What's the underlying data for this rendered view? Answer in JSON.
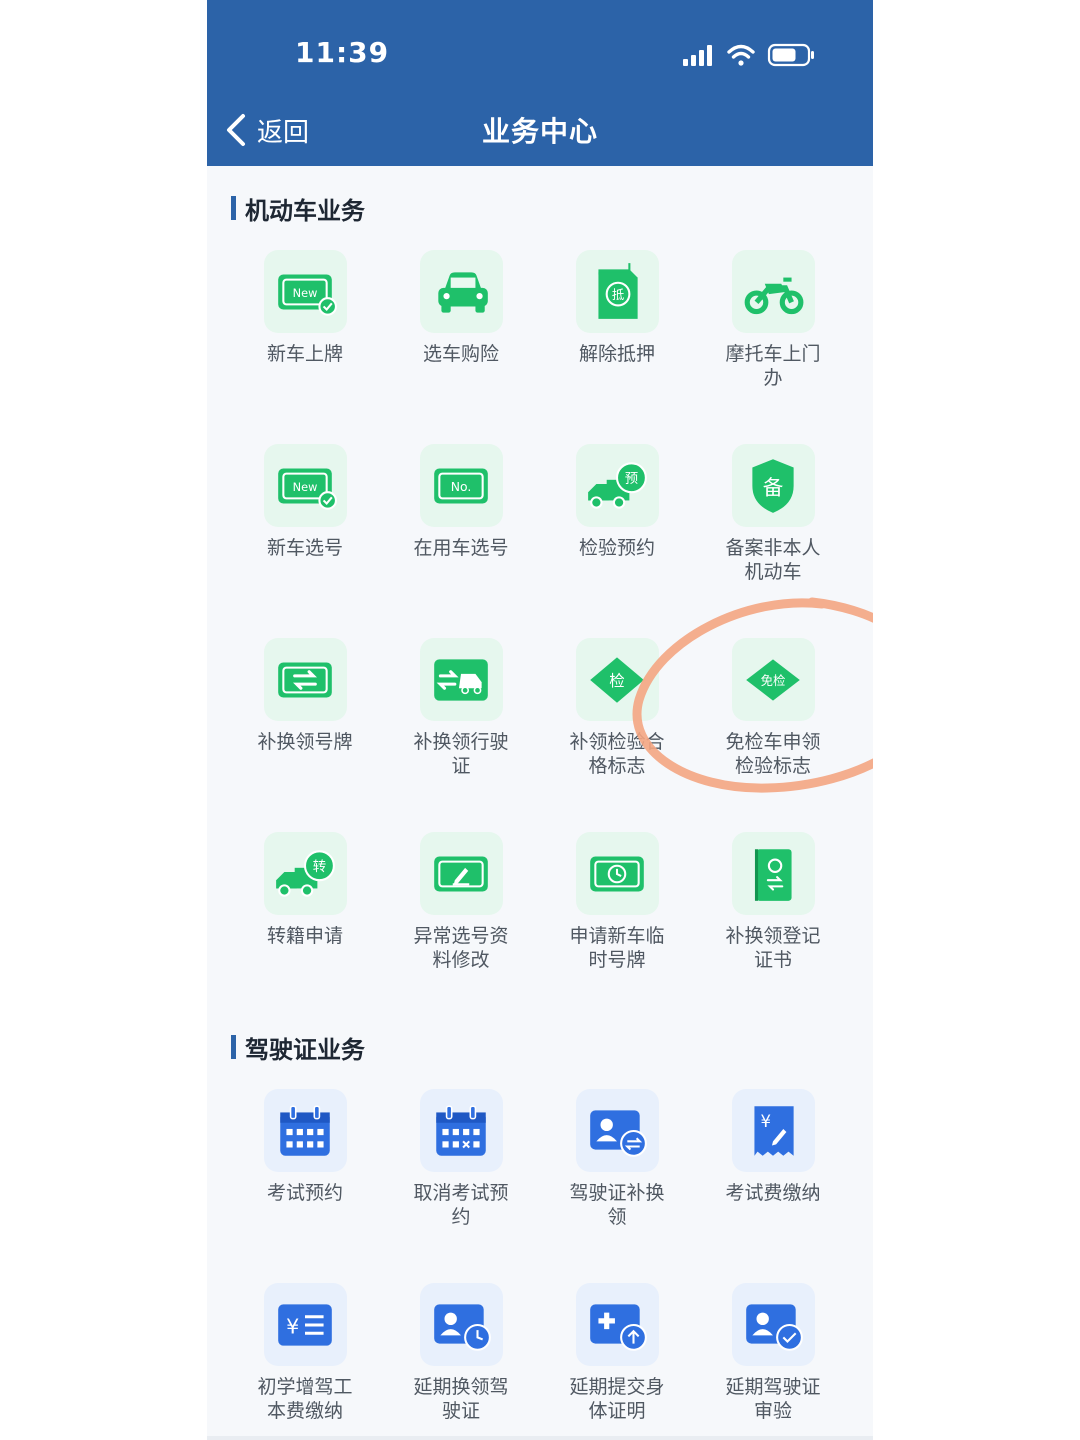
{
  "status_bar": {
    "time": "11:39"
  },
  "nav": {
    "back_label": "返回",
    "title": "业务中心"
  },
  "colors": {
    "header": "#2c63a8",
    "green_icon": "#1fc06a",
    "blue_icon": "#2f6fe0",
    "annotation": "#f4a582"
  },
  "sections": [
    {
      "title": "机动车业务",
      "items": [
        {
          "label": "新车上牌",
          "icon": "new-plate-icon"
        },
        {
          "label": "选车购险",
          "icon": "car-icon"
        },
        {
          "label": "解除抵押",
          "icon": "mortgage-release-icon"
        },
        {
          "label": "摩托车上门办",
          "icon": "motorcycle-icon"
        },
        {
          "label": "新车选号",
          "icon": "new-plate-icon"
        },
        {
          "label": "在用车选号",
          "icon": "no-plate-icon"
        },
        {
          "label": "检验预约",
          "icon": "truck-reserve-icon"
        },
        {
          "label": "备案非本人机动车",
          "icon": "shield-icon"
        },
        {
          "label": "补换领号牌",
          "icon": "plate-exchange-icon"
        },
        {
          "label": "补换领行驶证",
          "icon": "vehicle-exchange-icon"
        },
        {
          "label": "补领检验合格标志",
          "icon": "inspection-diamond-icon"
        },
        {
          "label": "免检车申领检验标志",
          "icon": "exempt-diamond-icon"
        },
        {
          "label": "转籍申请",
          "icon": "truck-transfer-icon"
        },
        {
          "label": "异常选号资料修改",
          "icon": "plate-edit-icon"
        },
        {
          "label": "申请新车临时号牌",
          "icon": "plate-clock-icon"
        },
        {
          "label": "补换领登记证书",
          "icon": "certificate-icon"
        }
      ]
    },
    {
      "title": "驾驶证业务",
      "items": [
        {
          "label": "考试预约",
          "icon": "calendar-icon"
        },
        {
          "label": "取消考试预约",
          "icon": "calendar-cancel-icon"
        },
        {
          "label": "驾驶证补换领",
          "icon": "license-exchange-icon"
        },
        {
          "label": "考试费缴纳",
          "icon": "fee-receipt-icon"
        },
        {
          "label": "初学增驾工本费缴纳",
          "icon": "yuan-list-icon"
        },
        {
          "label": "延期换领驾驶证",
          "icon": "license-clock-icon"
        },
        {
          "label": "延期提交身体证明",
          "icon": "medical-upload-icon"
        },
        {
          "label": "延期驾驶证审验",
          "icon": "license-check-icon"
        }
      ]
    }
  ]
}
